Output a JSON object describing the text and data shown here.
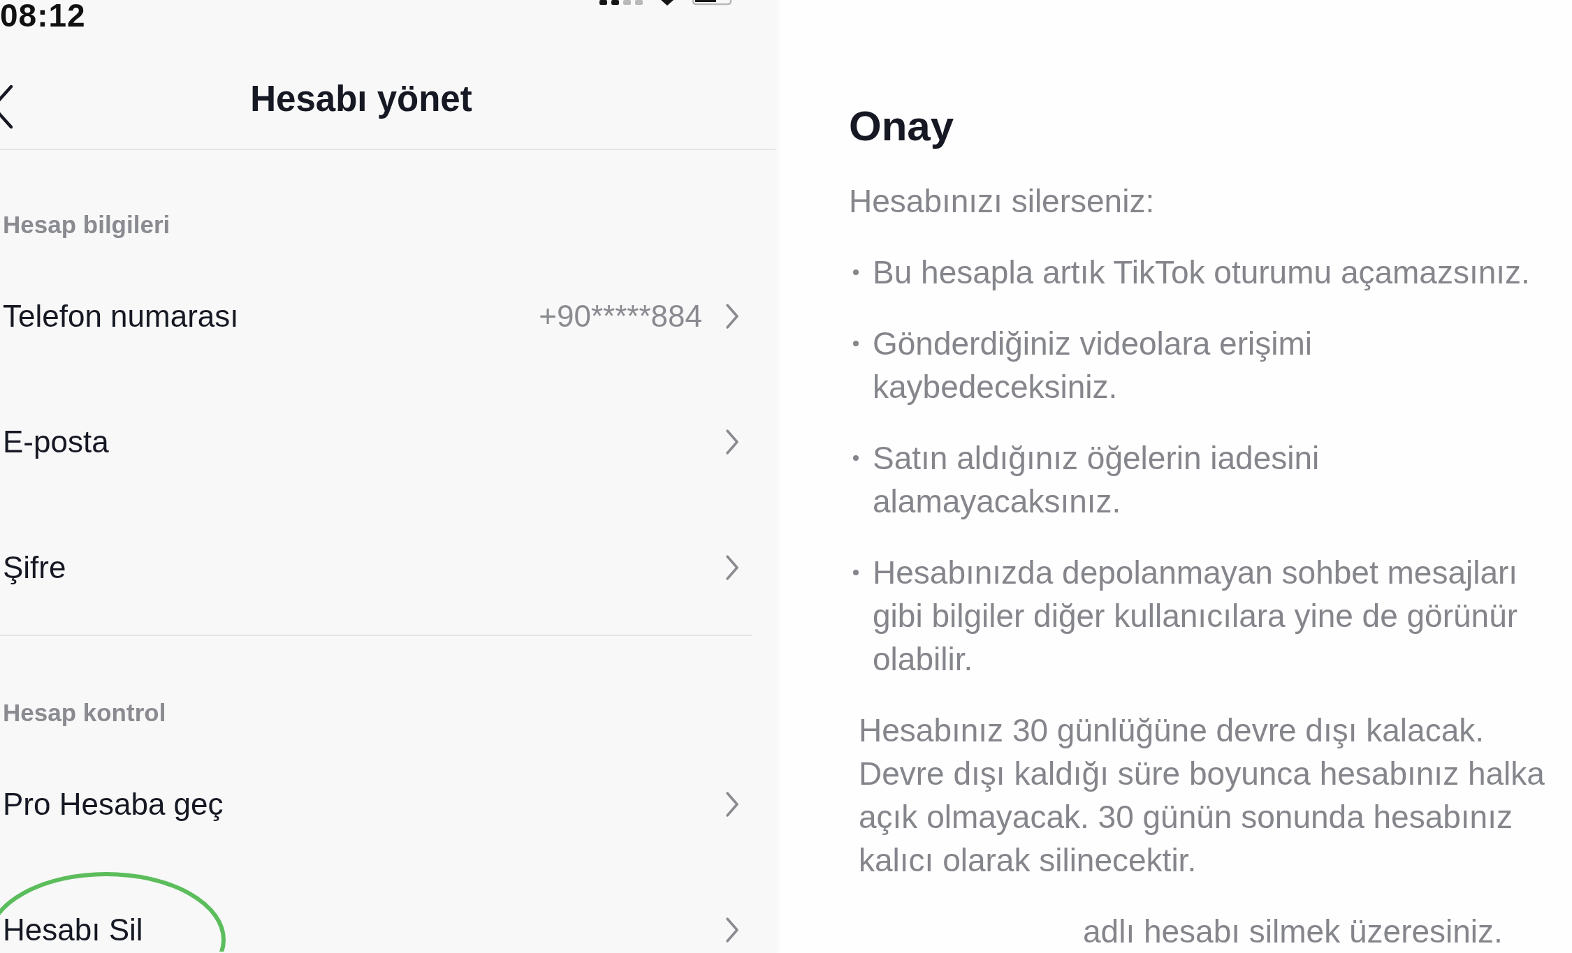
{
  "status_bar": {
    "time": "08:12"
  },
  "manage_account": {
    "title": "Hesabı yönet",
    "sections": [
      {
        "heading": "Hesap bilgileri",
        "rows": [
          {
            "label": "Telefon numarası",
            "value": "+90*****884",
            "circled": false
          },
          {
            "label": "E-posta",
            "circled": false
          },
          {
            "label": "Şifre",
            "circled": false
          }
        ]
      },
      {
        "heading": "Hesap kontrol",
        "rows": [
          {
            "label": "Pro Hesaba geç",
            "circled": false
          },
          {
            "label": "Hesabı Sil",
            "circled": true
          }
        ]
      }
    ]
  },
  "confirmation": {
    "title": "Onay",
    "intro": "Hesabınızı silerseniz:",
    "bullets": [
      "Bu hesapla artık TikTok oturumu açamazsınız.",
      "Gönderdiğiniz videolara erişimi kaybedeceksiniz.",
      "Satın aldığınız öğelerin iadesini alamayacaksınız.",
      "Hesabınızda depolanmayan sohbet mesajları gibi bilgiler diğer kullanıcılara yine de görünür olabilir."
    ],
    "notice": "Hesabınız 30 günlüğüne devre dışı kalacak. Devre dışı kaldığı süre boyunca hesabınız halka açık olmayacak. 30 günün sonunda hesabınız kalıcı olarak silinecektir.",
    "footer": "adlı hesabı silmek üzeresiniz."
  }
}
